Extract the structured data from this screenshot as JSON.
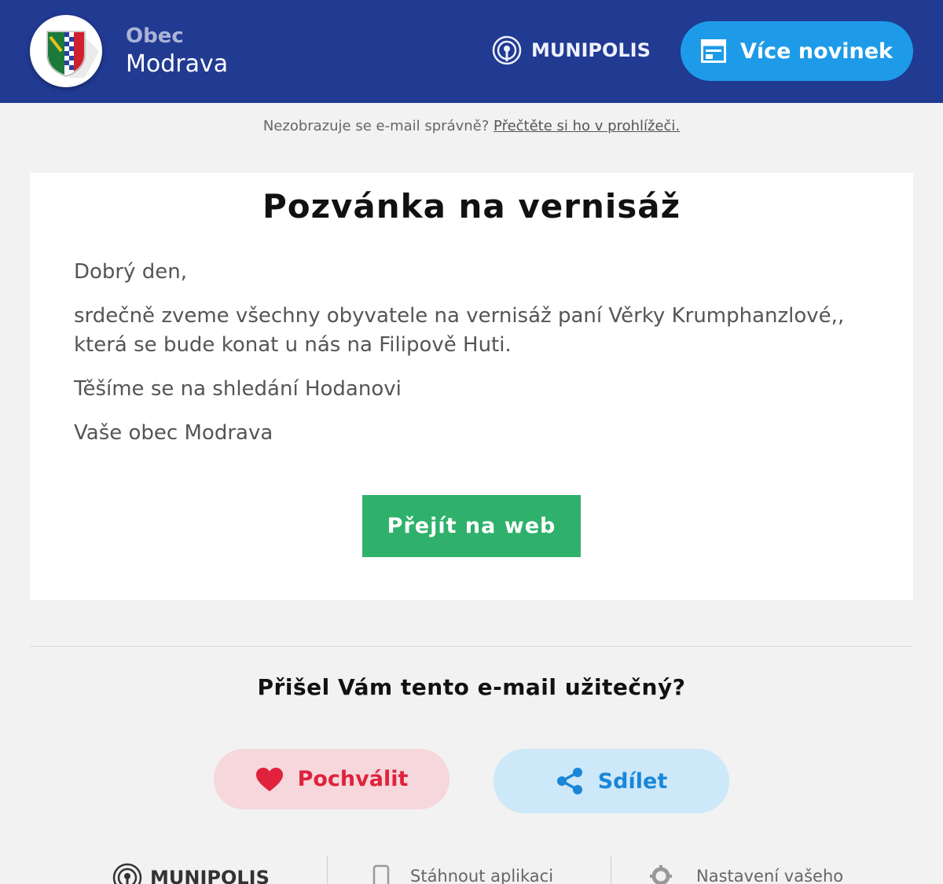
{
  "header": {
    "municipality_kind": "Obec",
    "municipality_name": "Modrava",
    "brand": "MUNIPOLIS",
    "more_news_label": "Více novinek"
  },
  "notice": {
    "text": "Nezobrazuje se e-mail správně?",
    "link_text": "Přečtěte si ho v prohlížeči."
  },
  "article": {
    "title": "Pozvánka na vernisáž",
    "greeting": "Dobrý den,",
    "paragraph": "srdečně zveme všechny obyvatele na vernisáž paní Věrky Krumphanzlové,, která se bude konat u nás na Filipově Huti.",
    "closing": "Těšíme se na shledání Hodanovi",
    "signature": "Vaše obec Modrava",
    "cta_label": "Přejít na web"
  },
  "feedback": {
    "question": "Přišel Vám tento e-mail užitečný?",
    "praise_label": "Pochválit",
    "share_label": "Sdílet"
  },
  "footer": {
    "brand": "MUNIPOLIS",
    "download_app": "Stáhnout aplikaci",
    "settings": "Nastavení vašeho"
  },
  "colors": {
    "header_bg": "#213a92",
    "accent_blue": "#1e9be8",
    "cta_green": "#2fb16b",
    "praise_red": "#e0223c",
    "share_blue": "#1a86d8"
  }
}
